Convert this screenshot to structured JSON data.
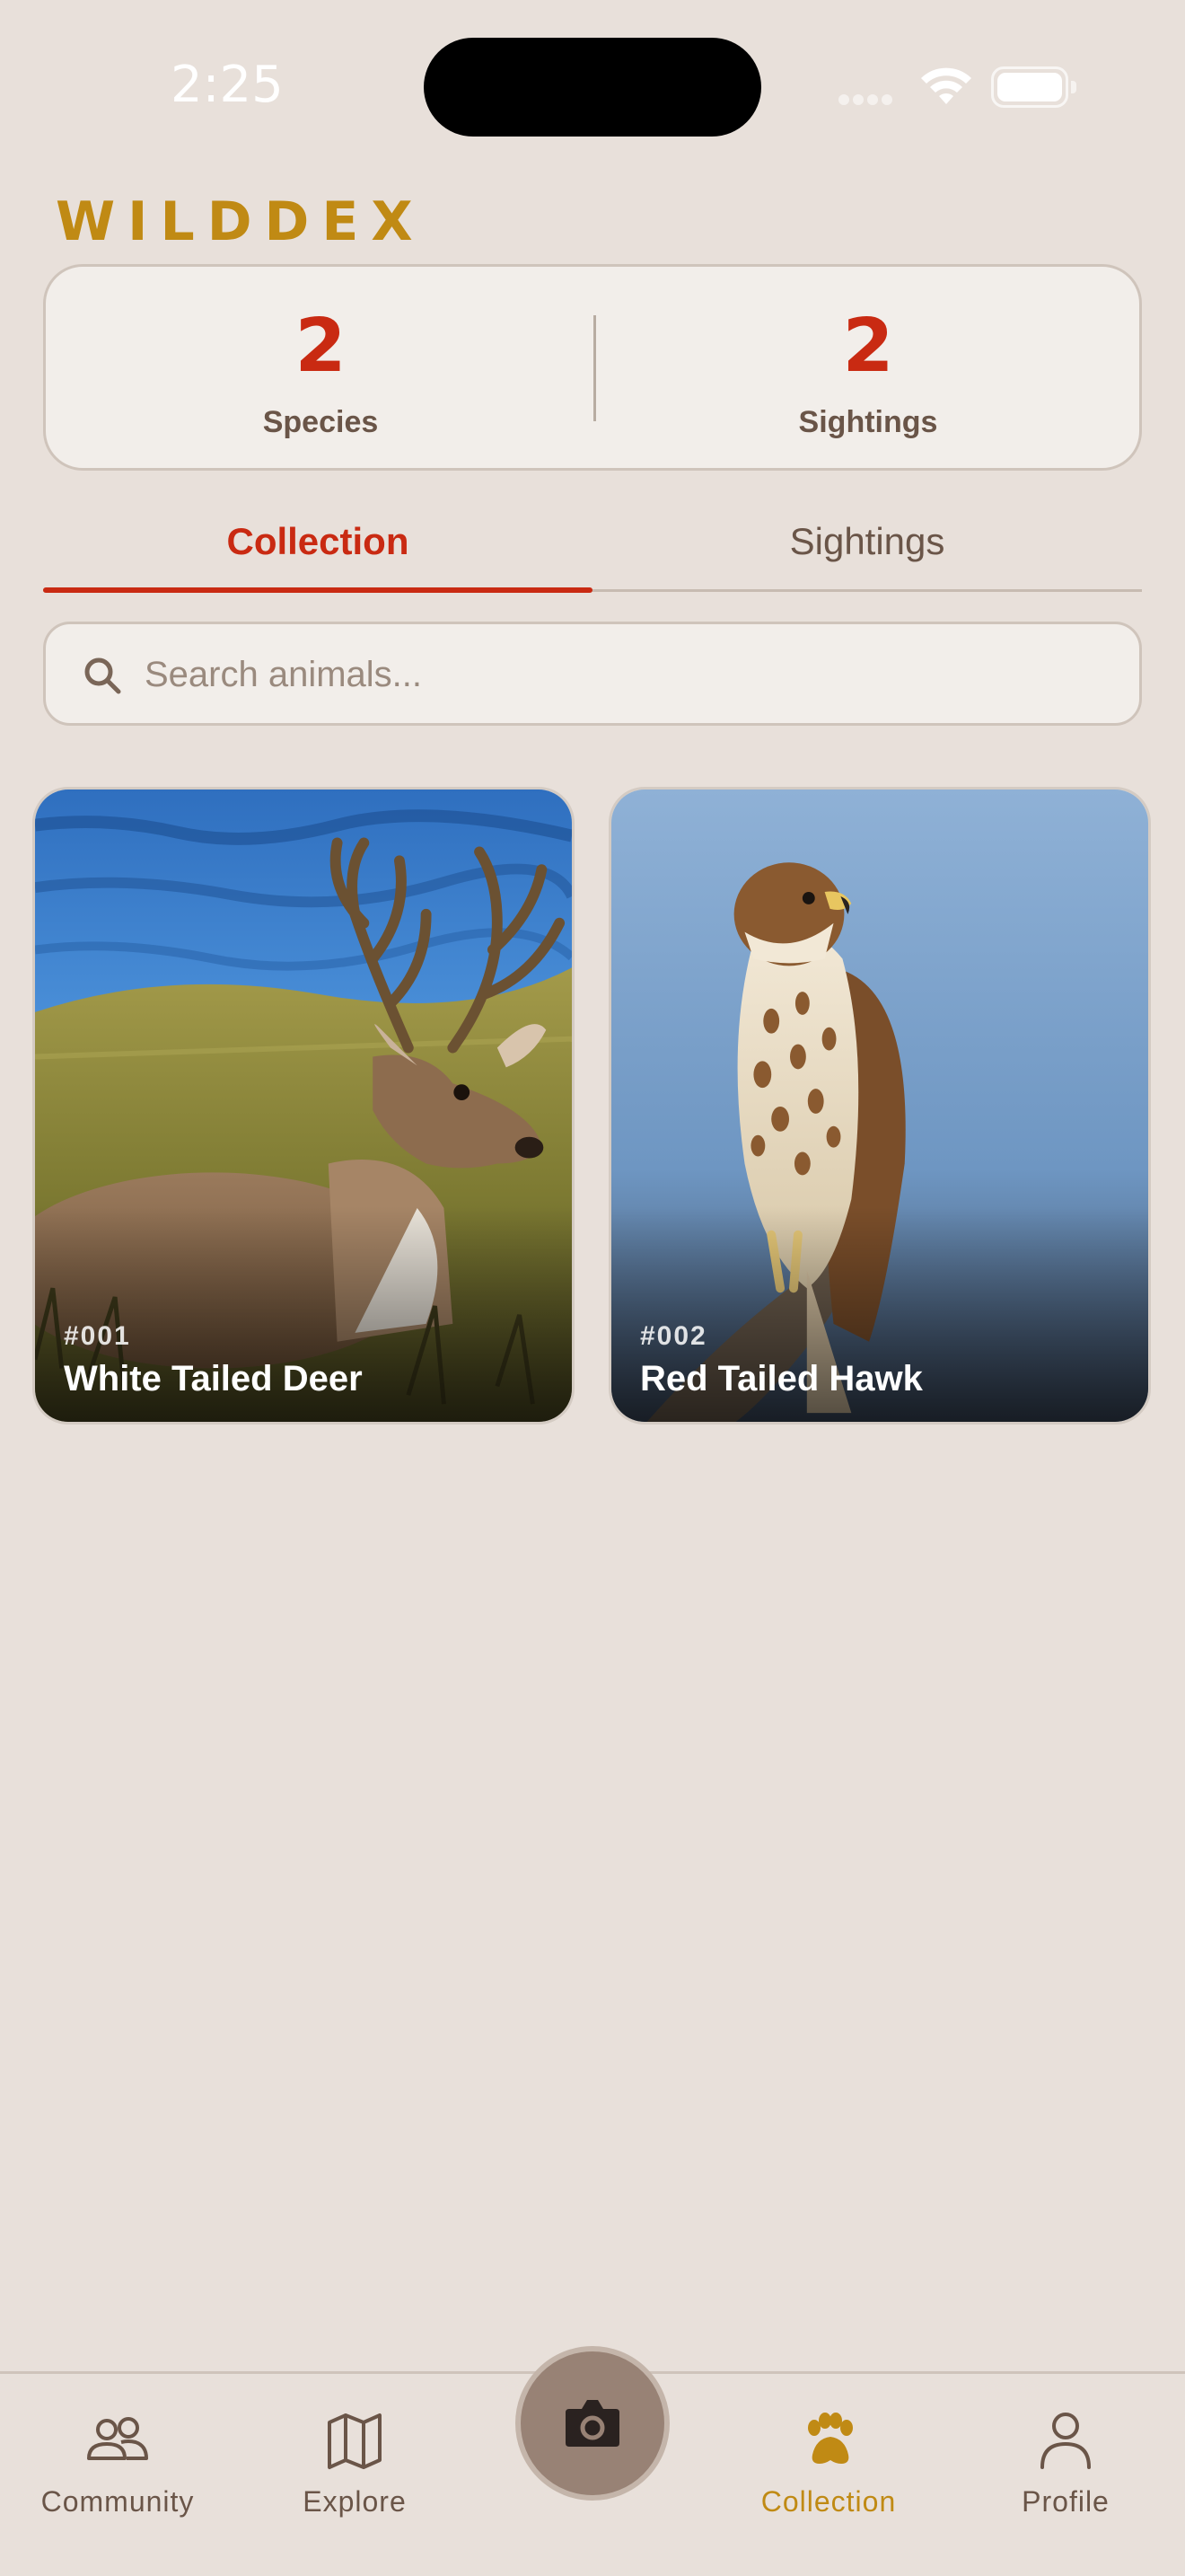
{
  "status_bar": {
    "time": "2:25"
  },
  "app": {
    "brand": "WILDDEX"
  },
  "stats": {
    "species_count": "2",
    "species_label": "Species",
    "sightings_count": "2",
    "sightings_label": "Sightings"
  },
  "tabs": [
    {
      "label": "Collection",
      "active": true
    },
    {
      "label": "Sightings",
      "active": false
    }
  ],
  "search": {
    "placeholder": "Search animals..."
  },
  "cards": [
    {
      "number": "#001",
      "name": "White Tailed Deer"
    },
    {
      "number": "#002",
      "name": "Red Tailed Hawk"
    }
  ],
  "nav": [
    {
      "label": "Community",
      "icon": "people-icon"
    },
    {
      "label": "Explore",
      "icon": "map-icon"
    },
    {
      "label": "",
      "icon": "camera-icon"
    },
    {
      "label": "Collection",
      "icon": "paw-icon",
      "active": true
    },
    {
      "label": "Profile",
      "icon": "person-icon"
    }
  ],
  "colors": {
    "accent_red": "#c92a12",
    "brand_gold": "#c08a14",
    "background": "#e8e0da"
  }
}
